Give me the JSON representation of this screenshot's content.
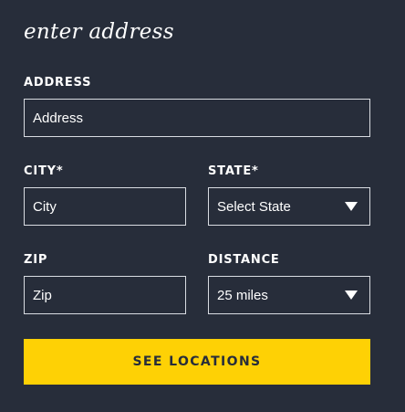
{
  "form": {
    "heading": "enter address",
    "address": {
      "label": "ADDRESS",
      "placeholder": "Address"
    },
    "city": {
      "label": "CITY*",
      "placeholder": "City"
    },
    "state": {
      "label": "STATE*",
      "selected": "Select State",
      "icon": "chevron-down-icon"
    },
    "zip": {
      "label": "ZIP",
      "placeholder": "Zip"
    },
    "distance": {
      "label": "DISTANCE",
      "selected": "25 miles",
      "icon": "chevron-down-icon"
    },
    "submit_label": "SEE LOCATIONS"
  },
  "colors": {
    "background": "#272d3a",
    "accent": "#fed105",
    "text": "#ffffff",
    "border": "#d9dce2"
  }
}
